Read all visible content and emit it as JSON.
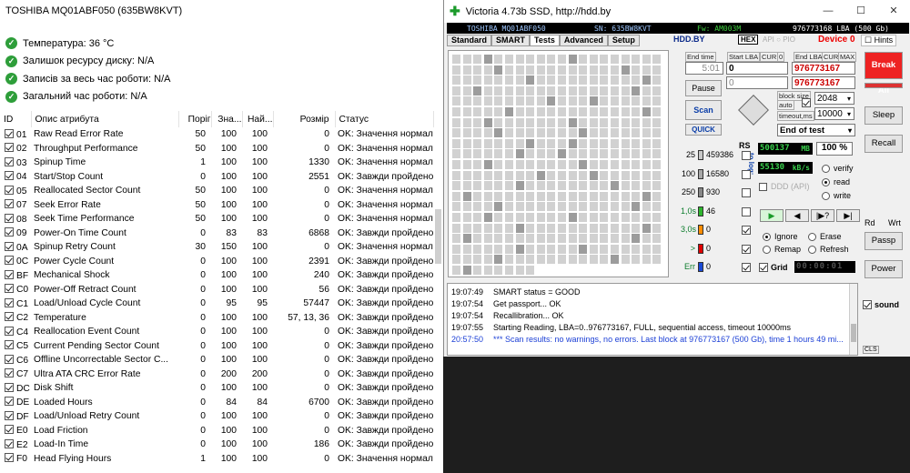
{
  "left_panel": {
    "title": "TOSHIBA MQ01ABF050 (635BW8KVT)",
    "summary": [
      "Температура: 36 °C",
      "Залишок ресурсу диску: N/A",
      "Записів за весь час роботи: N/A",
      "Загальний час роботи: N/A"
    ],
    "columns": [
      "ID",
      "Опис атрибута",
      "Поріг",
      "Зна...",
      "Най...",
      "Розмір",
      "Статус"
    ],
    "rows": [
      [
        "01",
        "Raw Read Error Rate",
        "50",
        "100",
        "100",
        "0",
        "OK: Значення нормал..."
      ],
      [
        "02",
        "Throughput Performance",
        "50",
        "100",
        "100",
        "0",
        "OK: Значення нормал..."
      ],
      [
        "03",
        "Spinup Time",
        "1",
        "100",
        "100",
        "1330",
        "OK: Значення нормал..."
      ],
      [
        "04",
        "Start/Stop Count",
        "0",
        "100",
        "100",
        "2551",
        "OK: Завжди пройдено"
      ],
      [
        "05",
        "Reallocated Sector Count",
        "50",
        "100",
        "100",
        "0",
        "OK: Значення нормал..."
      ],
      [
        "07",
        "Seek Error Rate",
        "50",
        "100",
        "100",
        "0",
        "OK: Значення нормал..."
      ],
      [
        "08",
        "Seek Time Performance",
        "50",
        "100",
        "100",
        "0",
        "OK: Значення нормал..."
      ],
      [
        "09",
        "Power-On Time Count",
        "0",
        "83",
        "83",
        "6868",
        "OK: Завжди пройдено"
      ],
      [
        "0A",
        "Spinup Retry Count",
        "30",
        "150",
        "100",
        "0",
        "OK: Значення нормал..."
      ],
      [
        "0C",
        "Power Cycle Count",
        "0",
        "100",
        "100",
        "2391",
        "OK: Завжди пройдено"
      ],
      [
        "BF",
        "Mechanical Shock",
        "0",
        "100",
        "100",
        "240",
        "OK: Завжди пройдено"
      ],
      [
        "C0",
        "Power-Off Retract Count",
        "0",
        "100",
        "100",
        "56",
        "OK: Завжди пройдено"
      ],
      [
        "C1",
        "Load/Unload Cycle Count",
        "0",
        "95",
        "95",
        "57447",
        "OK: Завжди пройдено"
      ],
      [
        "C2",
        "Temperature",
        "0",
        "100",
        "100",
        "57, 13, 36",
        "OK: Завжди пройдено"
      ],
      [
        "C4",
        "Reallocation Event Count",
        "0",
        "100",
        "100",
        "0",
        "OK: Завжди пройдено"
      ],
      [
        "C5",
        "Current Pending Sector Count",
        "0",
        "100",
        "100",
        "0",
        "OK: Завжди пройдено"
      ],
      [
        "C6",
        "Offline Uncorrectable Sector C...",
        "0",
        "100",
        "100",
        "0",
        "OK: Завжди пройдено"
      ],
      [
        "C7",
        "Ultra ATA CRC Error Rate",
        "0",
        "200",
        "200",
        "0",
        "OK: Завжди пройдено"
      ],
      [
        "DC",
        "Disk Shift",
        "0",
        "100",
        "100",
        "0",
        "OK: Завжди пройдено"
      ],
      [
        "DE",
        "Loaded Hours",
        "0",
        "84",
        "84",
        "6700",
        "OK: Завжди пройдено"
      ],
      [
        "DF",
        "Load/Unload Retry Count",
        "0",
        "100",
        "100",
        "0",
        "OK: Завжди пройдено"
      ],
      [
        "E0",
        "Load Friction",
        "0",
        "100",
        "100",
        "0",
        "OK: Завжди пройдено"
      ],
      [
        "E2",
        "Load-In Time",
        "0",
        "100",
        "100",
        "186",
        "OK: Завжди пройдено"
      ],
      [
        "F0",
        "Head Flying Hours",
        "1",
        "100",
        "100",
        "0",
        "OK: Значення нормал..."
      ]
    ]
  },
  "victoria": {
    "window_title": "Victoria 4.73b SSD, http://hdd.by",
    "window_buttons": [
      "—",
      "☐",
      "✕"
    ],
    "info": {
      "model": "TOSHIBA MQ01ABF050",
      "sn": "SN: 635BW8KVT",
      "fw": "Fw: AM003M",
      "lba": "976773168 LBA (500 Gb)"
    },
    "tabs": [
      "Standard",
      "SMART",
      "Tests",
      "Advanced",
      "Setup"
    ],
    "active_tab": "Tests",
    "hddby": "HDD.BY",
    "hex": "HEX",
    "api": "API",
    "pio": "PIO",
    "device": "Device 0",
    "hints": "Hints",
    "end_time_label": "End time",
    "end_time": "5:01",
    "start_lba_label": "Start LBA",
    "cur_label": "CUR",
    "zero": "0",
    "start_lba": "0",
    "start_lba_cur": "0",
    "end_lba_label": "End LBA",
    "max_label": "MAX",
    "end_lba": "976773167",
    "end_lba_cur": "976773167",
    "pause": "Pause",
    "scan": "Scan",
    "quick": "QUICK",
    "block_size_label": "block size",
    "auto_label": "auto",
    "block_size": "2048",
    "timeout_label": "timeout,ms",
    "timeout": "10000",
    "end_of_test": "End of test",
    "rs": "RS",
    "to_log": "to log:",
    "stats": [
      {
        "label": "25",
        "value": "459386",
        "color": "#c8c8c8"
      },
      {
        "label": "100",
        "value": "16580",
        "color": "#a8a8a8"
      },
      {
        "label": "250",
        "value": "930",
        "color": "#888888"
      },
      {
        "label": "1,0s",
        "value": "46",
        "color": "#2db52d"
      },
      {
        "label": "3,0s",
        "value": "0",
        "color": "#ff8c00"
      },
      {
        "label": ">",
        "value": "0",
        "color": "#e00000"
      },
      {
        "label": "Err",
        "value": "0",
        "color": "#1a4ad6"
      }
    ],
    "speed_mb": "500137",
    "mb_unit": "MB",
    "percent": "100",
    "pct_unit": "%",
    "speed_kbs": "55130",
    "kbs_unit": "kB/s",
    "ddd": "DDD (API)",
    "verify": "verify",
    "read": "read",
    "write": "write",
    "ignore": "Ignore",
    "erase": "Erase",
    "remap": "Remap",
    "refresh": "Refresh",
    "grid": "Grid",
    "timer": "00:00:01",
    "play_buttons": [
      "▶",
      "◀",
      "|▶?",
      "▶|"
    ],
    "right_buttons": {
      "break_all": "Break All",
      "sleep": "Sleep",
      "recall": "Recall",
      "rd": "Rd",
      "wrt": "Wrt",
      "passp": "Passp",
      "power": "Power",
      "sound": "sound",
      "cls": "CLS"
    },
    "log": [
      {
        "time": "19:07:49",
        "msg": "SMART status = GOOD",
        "blue": false
      },
      {
        "time": "19:07:54",
        "msg": "Get passport... OK",
        "blue": false
      },
      {
        "time": "19:07:54",
        "msg": "Recallibration... OK",
        "blue": false
      },
      {
        "time": "19:07:55",
        "msg": "Starting Reading, LBA=0..976773167, FULL, sequential access, timeout 10000ms",
        "blue": false
      },
      {
        "time": "20:57:50",
        "msg": "*** Scan results: no warnings, no errors. Last block at 976773167 (500 Gb), time 1 hours 49 mi...",
        "blue": true
      }
    ]
  }
}
